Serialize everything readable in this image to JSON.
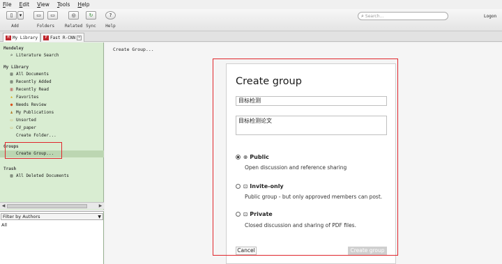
{
  "menu": [
    {
      "key": "F",
      "rest": "ile"
    },
    {
      "key": "E",
      "rest": "dit"
    },
    {
      "key": "V",
      "rest": "iew"
    },
    {
      "key": "T",
      "rest": "ools"
    },
    {
      "key": "H",
      "rest": "elp"
    }
  ],
  "toolbar": {
    "add_label": "Add",
    "folders_label": "Folders",
    "related_label": "Related",
    "sync_label": "Sync",
    "help_label": "Help",
    "search_placeholder": "Search...",
    "logon_label": "Logon"
  },
  "tabs": {
    "my_library": "My Library",
    "fast_rcnn": "Fast R-CNN"
  },
  "sidebar": {
    "mendeley_header": "Mendeley",
    "literature_search": "Literature Search",
    "my_library_header": "My Library",
    "items": [
      {
        "label": "All Documents",
        "icon": "documents-icon",
        "glyph": "▤"
      },
      {
        "label": "Recently Added",
        "icon": "recently-added-icon",
        "glyph": "▤"
      },
      {
        "label": "Recently Read",
        "icon": "recently-read-icon",
        "glyph": "▥"
      },
      {
        "label": "Favorites",
        "icon": "star-icon",
        "glyph": "★"
      },
      {
        "label": "Needs Review",
        "icon": "needs-review-icon",
        "glyph": "●"
      },
      {
        "label": "My Publications",
        "icon": "person-icon",
        "glyph": "♟"
      },
      {
        "label": "Unsorted",
        "icon": "folder-icon",
        "glyph": "▭"
      },
      {
        "label": "CV_paper",
        "icon": "folder-icon",
        "glyph": "▭"
      }
    ],
    "create_folder": "Create Folder...",
    "groups_header": "Groups",
    "create_group": "Create Group...",
    "trash_header": "Trash",
    "all_deleted": "All Deleted Documents"
  },
  "filter": {
    "label": "Filter by Authors",
    "value": "All"
  },
  "main": {
    "crumb": "Create Group..."
  },
  "dialog": {
    "title": "Create group",
    "name_value": "目标检测",
    "description_value": "目标检测论文",
    "options": [
      {
        "label": "Public",
        "desc": "Open discussion and reference sharing",
        "icon": "globe-icon",
        "glyph": "⊕",
        "selected": true
      },
      {
        "label": "Invite-only",
        "desc": "Public group - but only approved members can post.",
        "icon": "lock-icon",
        "glyph": "⊡",
        "selected": false
      },
      {
        "label": "Private",
        "desc": "Closed discussion and sharing of PDF files.",
        "icon": "lock-icon",
        "glyph": "⊡",
        "selected": false
      }
    ],
    "cancel_label": "Cancel",
    "create_label": "Create group"
  }
}
